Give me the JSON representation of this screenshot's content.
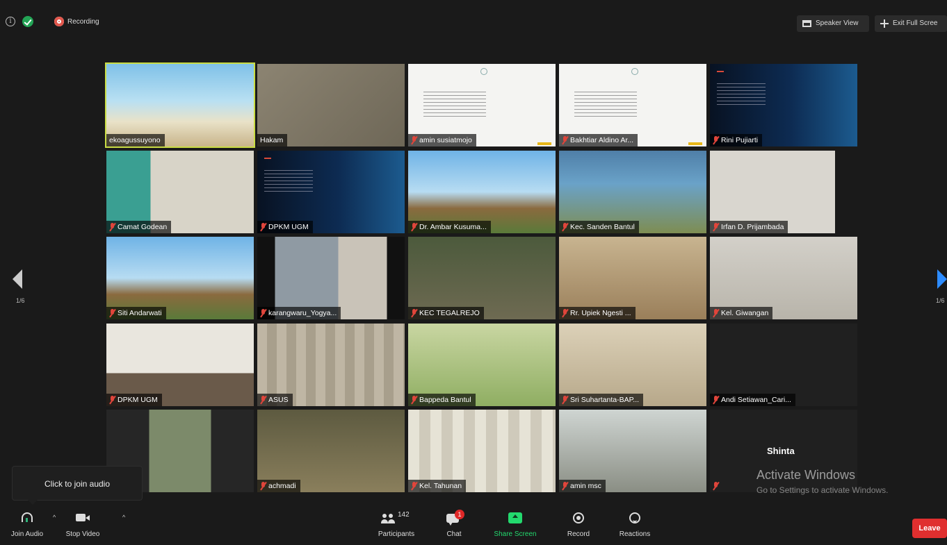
{
  "topbar": {
    "recording_label": "Recording",
    "speaker_view_label": "Speaker View",
    "exit_full_screen_label": "Exit Full Scree"
  },
  "pagination": {
    "left": "1/6",
    "right": "1/6"
  },
  "participants": [
    {
      "name": "ekoagussuyono",
      "muted": false,
      "active": true,
      "bg": "beach"
    },
    {
      "name": "Hakam",
      "muted": false,
      "bg": "plain-beige"
    },
    {
      "name": "amin susiatmojo",
      "muted": true,
      "bg": "slide-white"
    },
    {
      "name": "Bakhtiar Aldino Ar...",
      "muted": true,
      "bg": "slide-white"
    },
    {
      "name": "Rini Pujiarti",
      "muted": true,
      "bg": "slide-blue"
    },
    {
      "name": "Camat Godean",
      "muted": true,
      "bg": "office-teal"
    },
    {
      "name": "DPKM UGM",
      "muted": true,
      "bg": "slide-blue"
    },
    {
      "name": "Dr. Ambar Kusuma...",
      "muted": true,
      "bg": "campus"
    },
    {
      "name": "Kec. Sanden Bantul",
      "muted": true,
      "bg": "outdoor-arch"
    },
    {
      "name": "Irfan D. Prijambada",
      "muted": true,
      "bg": "gallery-wall"
    },
    {
      "name": "Siti Andarwati",
      "muted": true,
      "bg": "campus"
    },
    {
      "name": "karangwaru_Yogya...",
      "muted": true,
      "bg": "room-dark"
    },
    {
      "name": "KEC TEGALREJO",
      "muted": true,
      "bg": "office-green"
    },
    {
      "name": "Rr. Upiek Ngesti ...",
      "muted": true,
      "bg": "living-room"
    },
    {
      "name": "Kel. Giwangan",
      "muted": true,
      "bg": "grey-wall"
    },
    {
      "name": "DPKM UGM",
      "muted": true,
      "bg": "meeting-room"
    },
    {
      "name": "ASUS",
      "muted": true,
      "bg": "curtain"
    },
    {
      "name": "Bappeda Bantul",
      "muted": true,
      "bg": "bamboo"
    },
    {
      "name": "Sri Suhartanta-BAP...",
      "muted": true,
      "bg": "beige-wall"
    },
    {
      "name": "Andi Setiawan_Cari...",
      "muted": true,
      "bg": "dark"
    },
    {
      "name": "",
      "muted": false,
      "bg": "portrait"
    },
    {
      "name": "achmadi",
      "muted": true,
      "bg": "house"
    },
    {
      "name": "Kel. Tahunan",
      "muted": true,
      "bg": "curtain-light"
    },
    {
      "name": "amin msc",
      "muted": true,
      "bg": "cafe"
    },
    {
      "name": "",
      "muted": true,
      "bg": "dark"
    }
  ],
  "name_only_tile_label": "Shinta",
  "watermark": {
    "title": "Activate Windows",
    "subtitle": "Go to Settings to activate Windows."
  },
  "tooltip": {
    "text": "Click to join audio"
  },
  "toolbar": {
    "join_audio": "Join Audio",
    "stop_video": "Stop Video",
    "participants": "Participants",
    "participants_count": "142",
    "chat": "Chat",
    "chat_badge": "1",
    "share_screen": "Share Screen",
    "record": "Record",
    "reactions": "Reactions",
    "leave": "Leave"
  },
  "colors": {
    "active_speaker": "#c9dc44",
    "share_green": "#23d96e",
    "leave_red": "#e02f2f",
    "next_arrow": "#2d8cff"
  }
}
